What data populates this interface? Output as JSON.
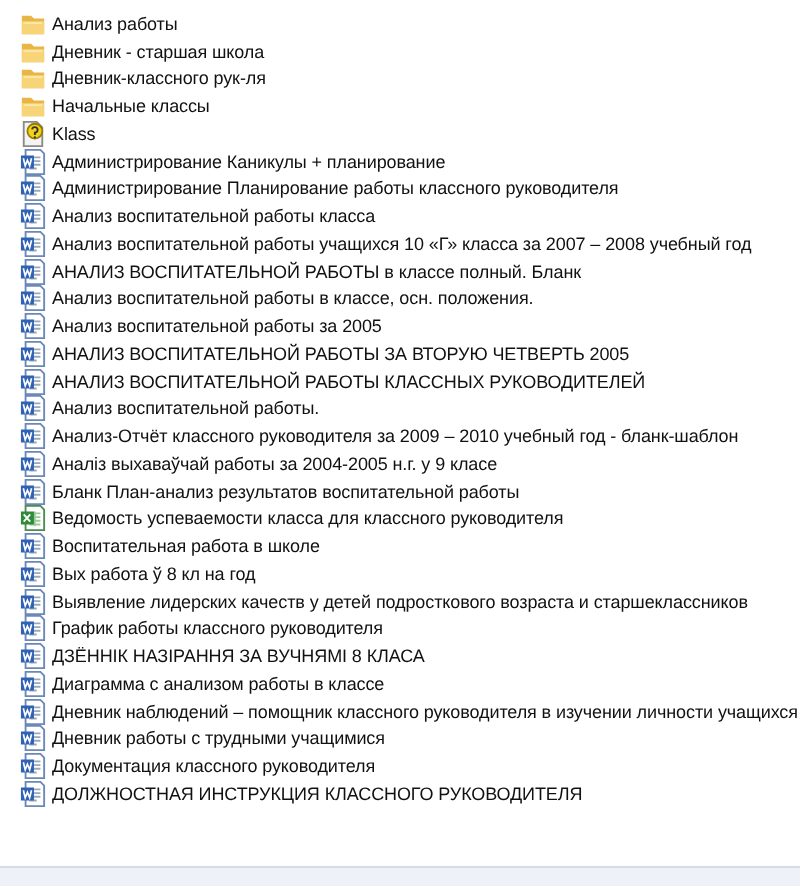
{
  "files": [
    {
      "kind": "folder",
      "name": "Анализ работы"
    },
    {
      "kind": "folder",
      "name": "Дневник - старшая школа"
    },
    {
      "kind": "folder",
      "name": "Дневник-классного рук-ля"
    },
    {
      "kind": "folder",
      "name": "Начальные классы"
    },
    {
      "kind": "unknown",
      "name": "Klass"
    },
    {
      "kind": "word",
      "name": "Администрирование  Каникулы + планирование"
    },
    {
      "kind": "word",
      "name": "Администрирование  Планирование работы классного руководителя"
    },
    {
      "kind": "word",
      "name": "Анализ воспитательной  работы класса"
    },
    {
      "kind": "word",
      "name": "Анализ воспитательной работы  учащихся 10 «Г» класса за 2007 – 2008 учебный год"
    },
    {
      "kind": "word",
      "name": "АНАЛИЗ ВОСПИТАТЕЛЬНОЙ РАБОТЫ в классе полный. Бланк"
    },
    {
      "kind": "word",
      "name": "Анализ воспитательной работы в классе, осн. положения."
    },
    {
      "kind": "word",
      "name": "Анализ воспитательной работы за 2005"
    },
    {
      "kind": "word",
      "name": "АНАЛИЗ ВОСПИТАТЕЛЬНОЙ РАБОТЫ ЗА ВТОРУЮ ЧЕТВЕРТЬ 2005"
    },
    {
      "kind": "word",
      "name": "АНАЛИЗ ВОСПИТАТЕЛЬНОЙ РАБОТЫ КЛАССНЫХ РУКОВОДИТЕЛЕЙ"
    },
    {
      "kind": "word",
      "name": "Анализ воспитательной работы."
    },
    {
      "kind": "word",
      "name": "Анализ-Отчёт классного руководителя за 2009 – 2010 учебный год - бланк-шаблон"
    },
    {
      "kind": "word",
      "name": "Аналіз выхаваўчай работы за 2004-2005 н.г. у 9 класе"
    },
    {
      "kind": "word",
      "name": "Бланк План-анализ результатов воспитательной работы"
    },
    {
      "kind": "excel",
      "name": "Ведомость успеваемости класса для классного руководителя"
    },
    {
      "kind": "word",
      "name": "Воспитательная работа в школе"
    },
    {
      "kind": "word",
      "name": "Вых работа ў 8 кл на год"
    },
    {
      "kind": "word",
      "name": "Выявление лидерских качеств у детей подросткового возраста и старшеклассников"
    },
    {
      "kind": "word",
      "name": "График работы классного руководителя"
    },
    {
      "kind": "word",
      "name": "ДЗЁННІК НАЗІРАННЯ ЗА ВУЧНЯМІ 8 КЛАСА"
    },
    {
      "kind": "word",
      "name": "Диаграмма с анализом работы в классе"
    },
    {
      "kind": "word",
      "name": "Дневник наблюдений – помощник классного руководителя в изучении личности учащихся"
    },
    {
      "kind": "word",
      "name": "Дневник работы с трудными учащимися"
    },
    {
      "kind": "word",
      "name": "Документация классного руководителя"
    },
    {
      "kind": "word",
      "name": "ДОЛЖНОСТНАЯ ИНСТРУКЦИЯ КЛАССНОГО РУКОВОДИТЕЛЯ"
    }
  ]
}
